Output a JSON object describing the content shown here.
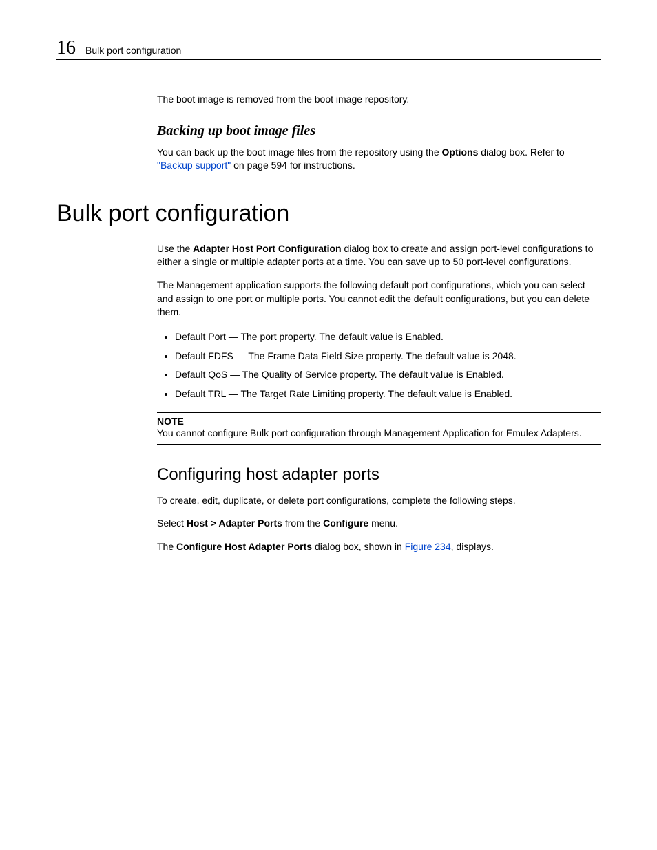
{
  "header": {
    "chapter_number": "16",
    "title": "Bulk port configuration"
  },
  "intro": {
    "removed": "The boot image is removed from the boot image repository."
  },
  "backing": {
    "heading": "Backing up boot image files",
    "p_pre": "You can back up the boot image files from the repository using the ",
    "p_bold": "Options",
    "p_mid": " dialog box. Refer to ",
    "link": "\"Backup support\"",
    "p_after": " on page 594 for instructions."
  },
  "bulk": {
    "heading": "Bulk port configuration",
    "p1_pre": "Use the ",
    "p1_bold": "Adapter Host Port Configuration",
    "p1_post": " dialog box to create and assign port-level configurations to either a single or multiple adapter ports at a time. You can save up to 50 port-level configurations.",
    "p2": "The Management application supports the following default port configurations, which you can select and assign to one port or multiple ports. You cannot edit the default configurations, but you can delete them.",
    "bullets": [
      "Default Port — The port property. The default value is Enabled.",
      "Default FDFS — The Frame Data Field Size property. The default value is 2048.",
      "Default QoS — The Quality of Service property. The default value is Enabled.",
      "Default TRL — The Target Rate Limiting property. The default value is Enabled."
    ],
    "note_label": "NOTE",
    "note_text": "You cannot configure Bulk port configuration through Management Application for Emulex Adapters."
  },
  "configuring": {
    "heading": "Configuring host adapter ports",
    "p1": "To create, edit, duplicate, or delete port configurations, complete the following steps.",
    "p2_pre": "Select ",
    "p2_b1": "Host > Adapter Ports",
    "p2_mid": " from the ",
    "p2_b2": "Configure",
    "p2_post": " menu.",
    "p3_pre": "The ",
    "p3_b": "Configure Host Adapter Ports",
    "p3_mid": " dialog box, shown in ",
    "p3_link": "Figure 234",
    "p3_post": ", displays."
  }
}
